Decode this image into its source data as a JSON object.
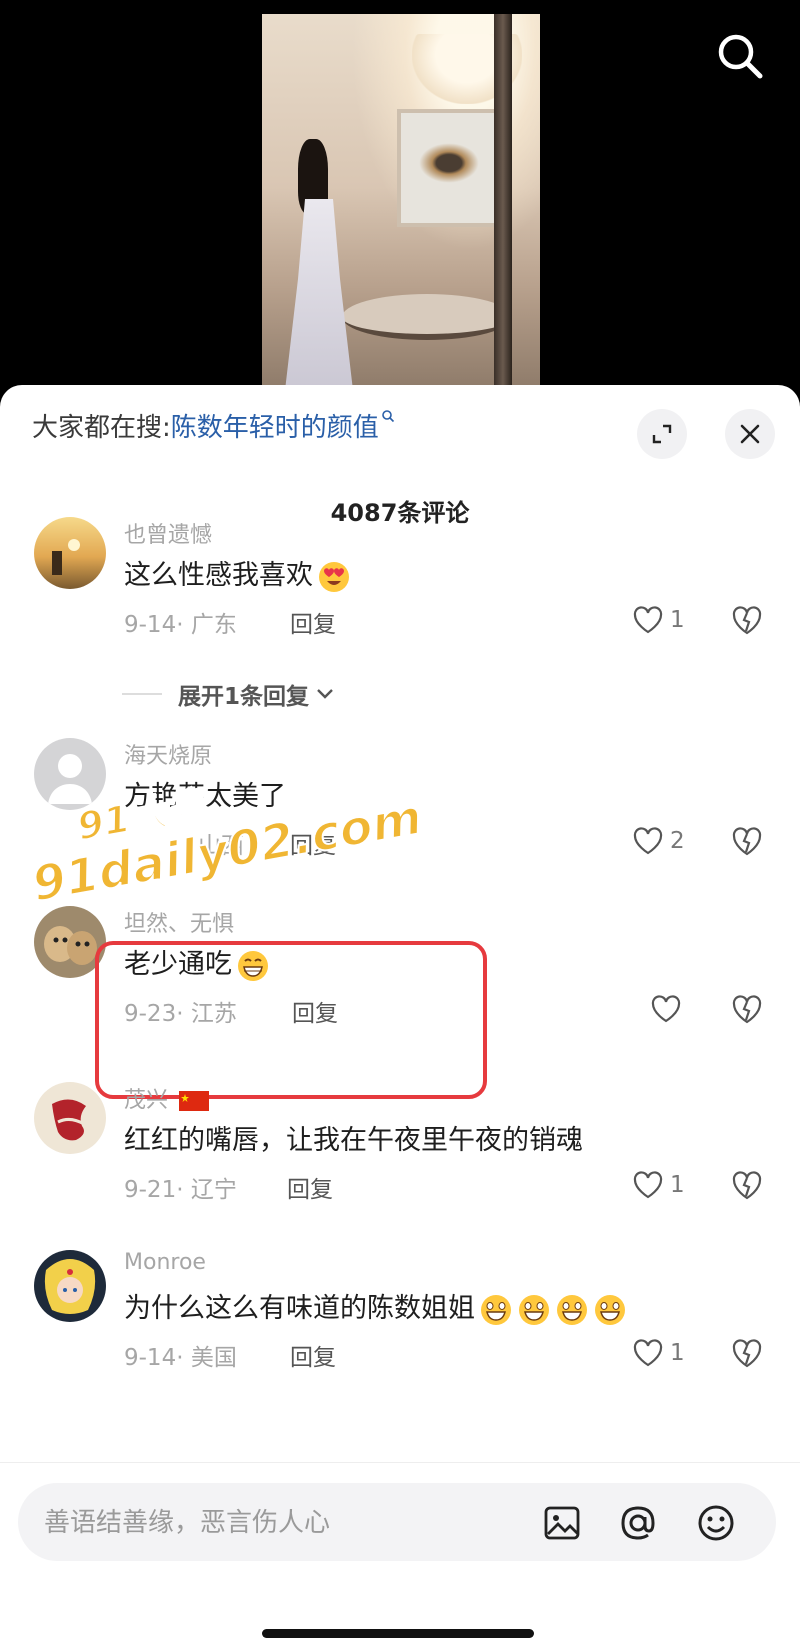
{
  "header": {
    "search_icon": "search-icon"
  },
  "sheet": {
    "trending_prefix": "大家都在搜:",
    "trending_keyword": "陈数年轻时的颜值",
    "comment_count": "4087条评论",
    "expand_icon": "expand-icon",
    "close_icon": "close-icon"
  },
  "comments": [
    {
      "username": "也曾遗憾",
      "text": "这么性感我喜欢",
      "emoji": "heart-eyes-emoji",
      "date": "9-14",
      "location": "广东",
      "reply": "回复",
      "likes": "1"
    },
    {
      "username": "海天烧原",
      "text": "方艳芸太美了",
      "date": "",
      "location": "山西",
      "reply": "回复",
      "likes": "2"
    },
    {
      "username": "坦然、无惧",
      "text": "老少通吃",
      "emoji": "grin-emoji",
      "date": "9-23",
      "location": "江苏",
      "reply": "回复",
      "likes": ""
    },
    {
      "username": "茂兴",
      "flag": "china-flag",
      "text": "红红的嘴唇，让我在午夜里午夜的销魂",
      "date": "9-21",
      "location": "辽宁",
      "reply": "回复",
      "likes": "1"
    },
    {
      "username": "Monroe",
      "text": "为什么这么有味道的陈数姐姐",
      "emoji": "grin-emoji",
      "emoji_count": 4,
      "date": "9-14",
      "location": "美国",
      "reply": "回复",
      "likes": "1"
    }
  ],
  "expand_replies": "展开1条回复",
  "watermark": {
    "line1": "91大赛",
    "line2": "91daily02.com"
  },
  "input": {
    "placeholder": "善语结善缘，恶言伤人心"
  },
  "colors": {
    "keyword": "#2a5fa8",
    "highlight_box": "#e63a3e",
    "watermark": "#f0b633"
  }
}
